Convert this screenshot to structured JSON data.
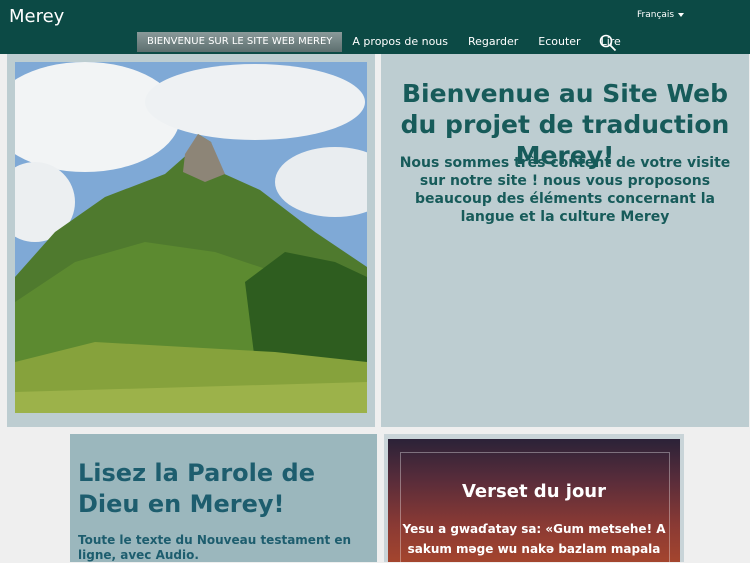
{
  "header": {
    "brand": "Merey",
    "language": "Français",
    "nav": [
      "BIENVENUE SUR LE SITE WEB MEREY",
      "A propos de nous",
      "Regarder",
      "Ecouter",
      "Lire"
    ],
    "search_icon": "search-icon"
  },
  "welcome": {
    "title": "Bienvenue au Site Web du projet de traduction Merey!",
    "text": "Nous sommes très content de votre visite sur notre site ! nous vous proposons beaucoup des éléments concernant la langue et la culture Merey"
  },
  "read": {
    "title": "Lisez la Parole de Dieu en Merey!",
    "text": "Toute le texte du Nouveau testament en ligne, avec Audio."
  },
  "verse": {
    "title": "Verset du jour",
    "text": "Yesu a gwaɗatay sa: «Gum metsehe! A sakum məge wu nakə bazlam mapala"
  },
  "colors": {
    "header_bg": "#0c4a45",
    "card_bg": "#bdcdd1",
    "title_text": "#175b5a"
  }
}
